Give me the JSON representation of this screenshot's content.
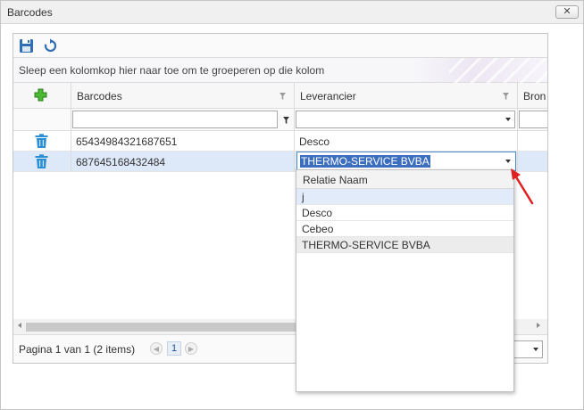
{
  "window": {
    "title": "Barcodes",
    "close_label": "✕"
  },
  "toolbar": {
    "save_icon": "save-icon",
    "refresh_icon": "refresh-icon"
  },
  "groupbar": {
    "text": "Sleep een kolomkop hier naar toe om te groeperen op die kolom"
  },
  "columns": [
    {
      "label": ""
    },
    {
      "label": "Barcodes"
    },
    {
      "label": "Leverancier"
    },
    {
      "label": "Bron"
    }
  ],
  "rows": [
    {
      "barcode": "65434984321687651",
      "leverancier": "Desco"
    },
    {
      "barcode": "687645168432484",
      "leverancier": "THERMO-SERVICE BVBA"
    }
  ],
  "dropdown": {
    "header": "Relatie Naam",
    "items": [
      "j",
      "Desco",
      "Cebeo",
      "THERMO-SERVICE BVBA"
    ]
  },
  "pager": {
    "info": "Pagina 1 van 1 (2 items)",
    "current_page": "1",
    "prev_icon": "◀",
    "next_icon": "▶"
  },
  "colors": {
    "accent": "#3c6ebf",
    "selected_row": "#dde8f8",
    "trash": "#2a8fd4",
    "add": "#3aa62a",
    "arrow": "#e02020"
  }
}
